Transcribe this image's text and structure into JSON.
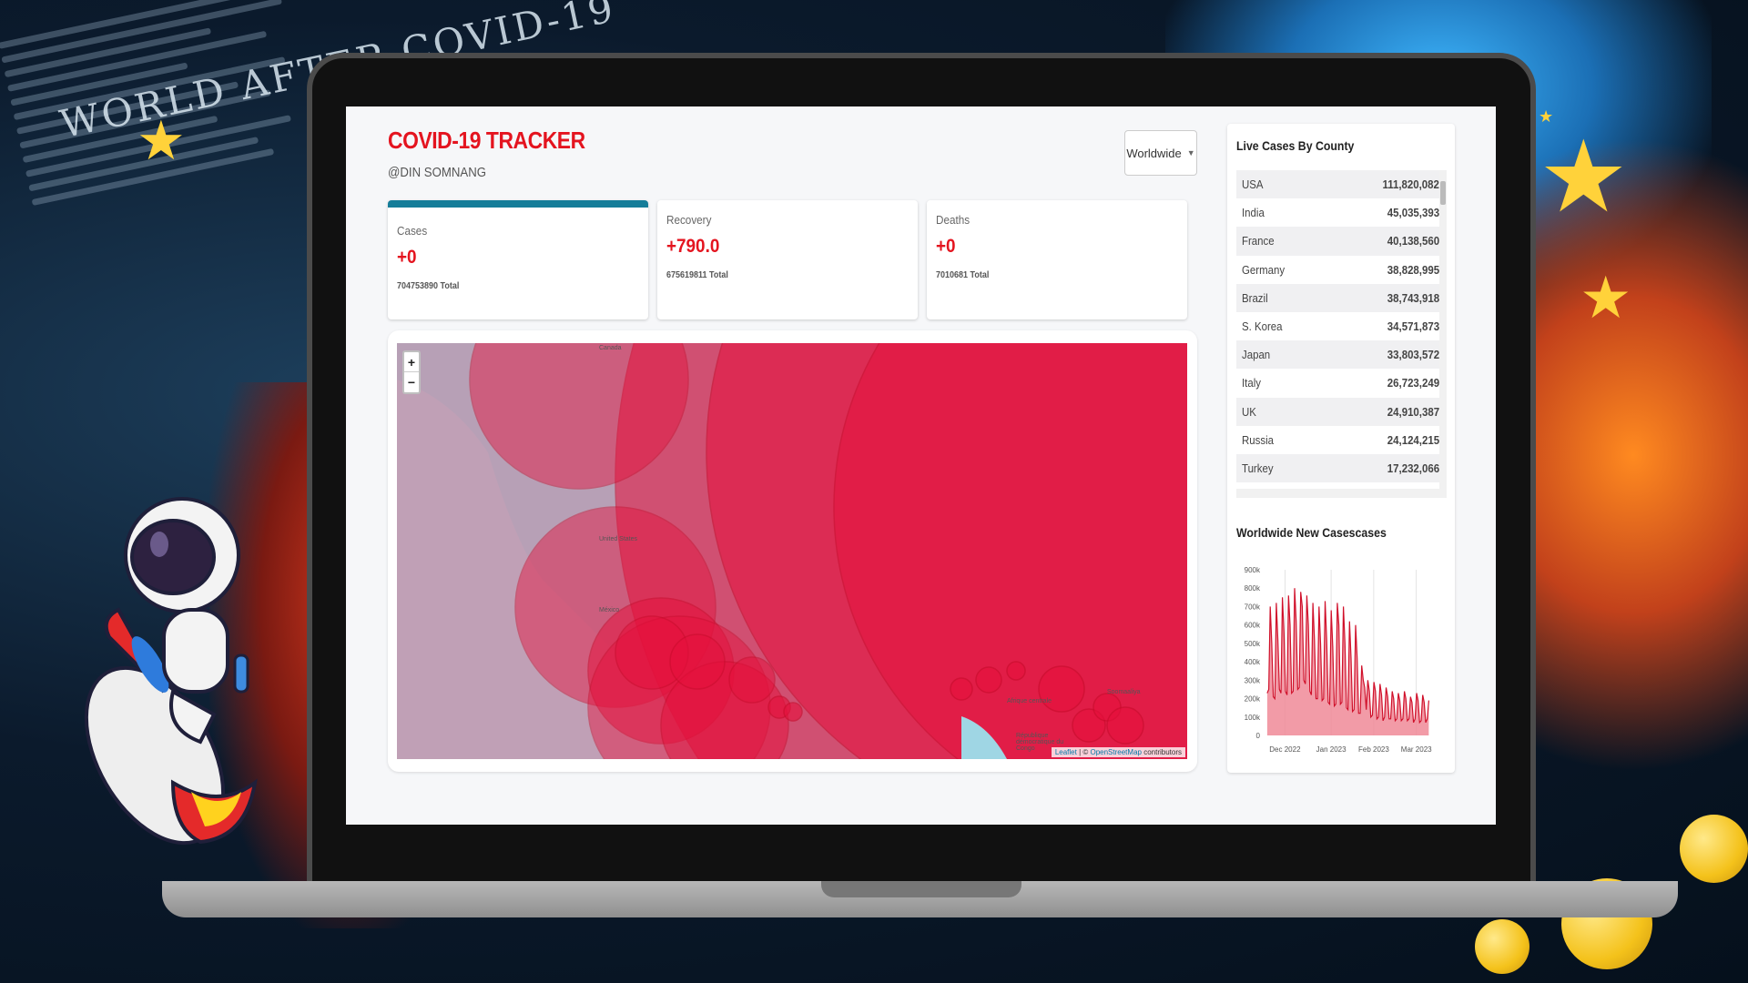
{
  "background": {
    "heading": "WORLD AFTER COVID-19"
  },
  "app": {
    "title": "COVID-19 TRACKER",
    "subtitle": "@DIN SOMNANG",
    "select_value": "Worldwide",
    "accent_color": "#e4141f",
    "active_border_color": "#157d99"
  },
  "cards": [
    {
      "label": "Cases",
      "value": "+0",
      "total": "704753890 Total"
    },
    {
      "label": "Recovery",
      "value": "+790.0",
      "total": "675619811 Total"
    },
    {
      "label": "Deaths",
      "value": "+0",
      "total": "7010681 Total"
    }
  ],
  "map": {
    "zoom_in": "+",
    "zoom_out": "−",
    "labels": [
      "Canada",
      "United States",
      "México",
      "République démocratique du Congo",
      "Soomaaliya",
      "Afrique centrale"
    ],
    "attribution_leaflet": "Leaflet",
    "attribution_sep": " | © ",
    "attribution_osm": "OpenStreetMap",
    "attribution_rest": " contributors"
  },
  "live_cases": {
    "title": "Live Cases By County",
    "rows": [
      {
        "country": "USA",
        "cases": "111,820,082"
      },
      {
        "country": "India",
        "cases": "45,035,393"
      },
      {
        "country": "France",
        "cases": "40,138,560"
      },
      {
        "country": "Germany",
        "cases": "38,828,995"
      },
      {
        "country": "Brazil",
        "cases": "38,743,918"
      },
      {
        "country": "S. Korea",
        "cases": "34,571,873"
      },
      {
        "country": "Japan",
        "cases": "33,803,572"
      },
      {
        "country": "Italy",
        "cases": "26,723,249"
      },
      {
        "country": "UK",
        "cases": "24,910,387"
      },
      {
        "country": "Russia",
        "cases": "24,124,215"
      },
      {
        "country": "Turkey",
        "cases": "17,232,066"
      }
    ]
  },
  "new_cases": {
    "title": "Worldwide New Casescases"
  },
  "chart_data": {
    "type": "area",
    "title": "Worldwide New Casescases",
    "x_ticks": [
      "Dec 2022",
      "Jan 2023",
      "Feb 2023",
      "Mar 2023"
    ],
    "y_ticks": [
      "0",
      "100k",
      "200k",
      "300k",
      "400k",
      "500k",
      "600k",
      "700k",
      "800k",
      "900k"
    ],
    "ylim": [
      0,
      900000
    ],
    "x_start": "2022-11-23",
    "values": [
      230000,
      250000,
      700000,
      500000,
      210000,
      200000,
      720000,
      520000,
      250000,
      230000,
      750000,
      560000,
      240000,
      220000,
      760000,
      600000,
      230000,
      240000,
      800000,
      620000,
      250000,
      260000,
      780000,
      700000,
      300000,
      280000,
      760000,
      600000,
      240000,
      220000,
      720000,
      520000,
      200000,
      200000,
      700000,
      500000,
      190000,
      200000,
      730000,
      520000,
      180000,
      170000,
      680000,
      480000,
      160000,
      170000,
      720000,
      600000,
      170000,
      180000,
      700000,
      500000,
      150000,
      140000,
      620000,
      420000,
      130000,
      140000,
      600000,
      420000,
      120000,
      120000,
      380000,
      300000,
      260000,
      140000,
      300000,
      240000,
      100000,
      110000,
      290000,
      240000,
      90000,
      100000,
      280000,
      220000,
      80000,
      100000,
      260000,
      210000,
      90000,
      90000,
      240000,
      200000,
      80000,
      90000,
      230000,
      190000,
      80000,
      90000,
      240000,
      200000,
      80000,
      90000,
      210000,
      180000,
      70000,
      90000,
      230000,
      190000,
      70000,
      80000,
      220000,
      180000,
      70000,
      90000,
      190000
    ],
    "fill_color": "#f08a98",
    "line_color": "#d0102a",
    "grid": false
  }
}
